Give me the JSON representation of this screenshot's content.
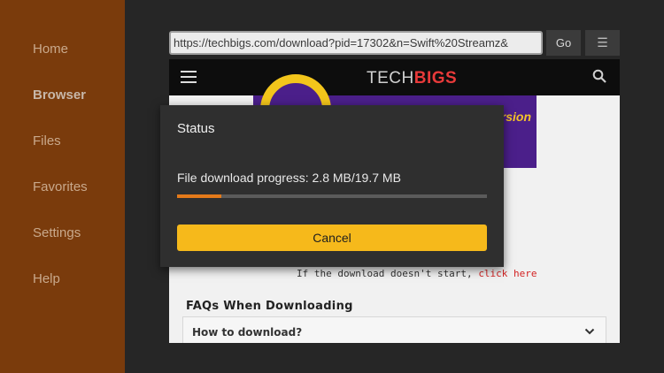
{
  "sidebar": {
    "items": [
      {
        "label": "Home"
      },
      {
        "label": "Browser"
      },
      {
        "label": "Files"
      },
      {
        "label": "Favorites"
      },
      {
        "label": "Settings"
      },
      {
        "label": "Help"
      }
    ],
    "active": "Browser",
    "bg_color": "#7a3b0c"
  },
  "toolbar": {
    "url": "https://techbigs.com/download?pid=17302&n=Swift%20Streamz&",
    "go_label": "Go",
    "menu_label": "☰"
  },
  "website": {
    "logo_part1": "TECH",
    "logo_part2": "BIGS",
    "banner_text": "ersion",
    "download_note": "If the download doesn't start, ",
    "download_link": "click here",
    "faq_title": "FAQs When Downloading",
    "faq_items": [
      {
        "question": "How to download?"
      }
    ]
  },
  "dialog": {
    "title": "Status",
    "message": "File download progress: 2.8 MB/19.7 MB",
    "progress_fraction": 0.142,
    "cancel_label": "Cancel",
    "accent_color": "#f6b91b",
    "progress_color": "#e47a1a"
  }
}
